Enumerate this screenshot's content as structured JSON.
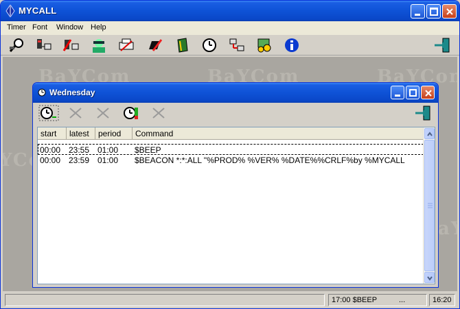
{
  "window": {
    "title": "MYCALL"
  },
  "menu": {
    "items": [
      "Timer",
      "Font",
      "Window",
      "Help"
    ]
  },
  "toolbar": {
    "icons": [
      "search-phone-icon",
      "phone-line-icon",
      "phone-delete-icon",
      "computer-link-icon",
      "user-agent-icon",
      "fax-print-icon",
      "pencil-book-icon",
      "green-book-icon",
      "clock-icon",
      "network-icon",
      "gear-computer-icon",
      "info-icon",
      "exit-door-icon"
    ]
  },
  "child_window": {
    "title": "Wednesday"
  },
  "child_toolbar": {
    "icons": [
      "clock-add-icon",
      "cut-disabled-icon",
      "cut-disabled-icon",
      "clock-edit-icon",
      "cut-disabled-icon",
      "exit-door-icon"
    ]
  },
  "table": {
    "columns": [
      "start",
      "latest",
      "period",
      "Command"
    ],
    "rows": [
      {
        "start": "00:00",
        "latest": "23:55",
        "period": "01:00",
        "command": "$BEEP"
      },
      {
        "start": "00:00",
        "latest": "23:59",
        "period": "01:00",
        "command": "$BEACON *:*:ALL \"%PROD% %VER% %DATE%%CRLF%by %MYCALL"
      }
    ]
  },
  "statusbar": {
    "message": "",
    "timer": "17:00 $BEEP",
    "ellipsis": "...",
    "clock": "16:20"
  },
  "watermark": {
    "text": "BaYCom"
  },
  "colors": {
    "title_blue": "#0a47c8",
    "desktop_gray": "#a9a6a0",
    "close_red": "#c7401a"
  }
}
